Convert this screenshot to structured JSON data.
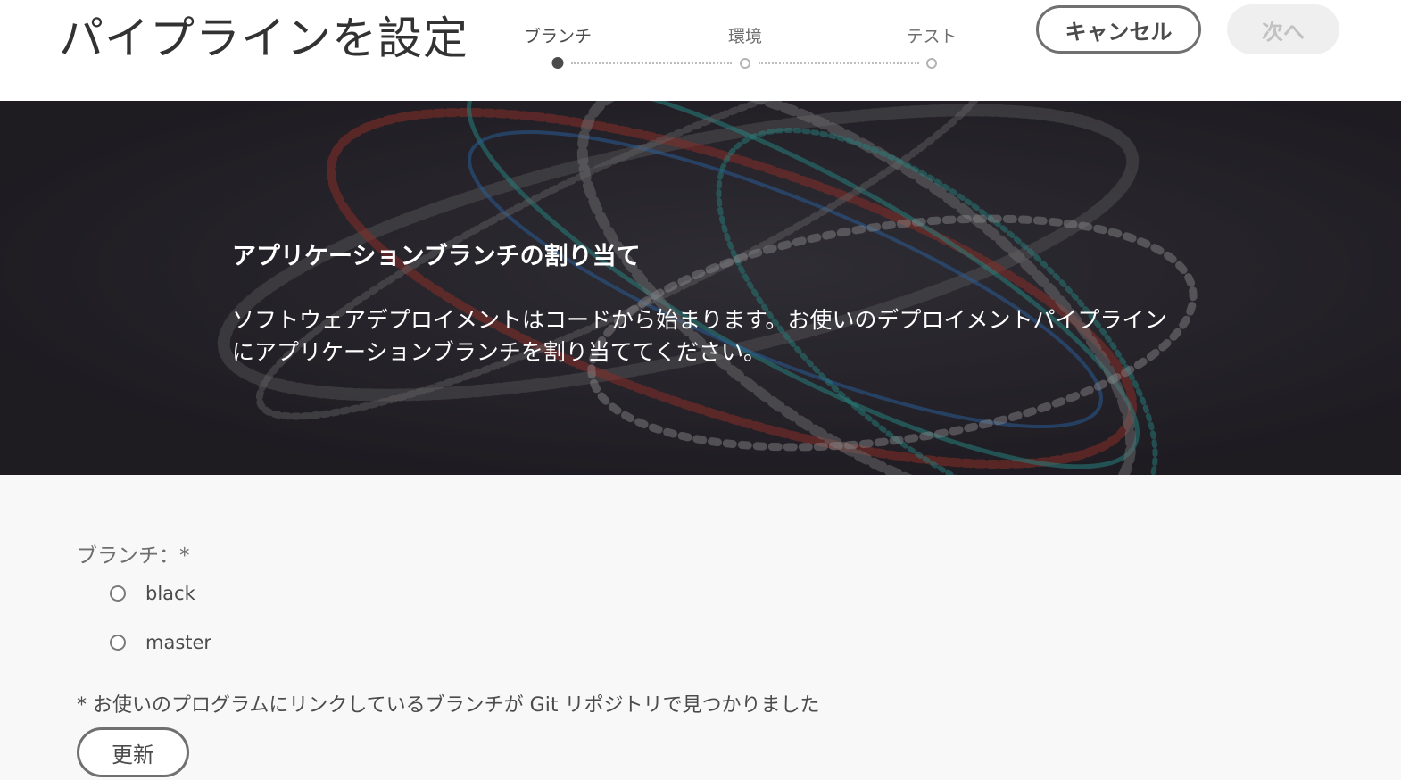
{
  "header": {
    "title": "パイプラインを設定",
    "steps": [
      {
        "label": "ブランチ",
        "state": "active"
      },
      {
        "label": "環境",
        "state": "pending"
      },
      {
        "label": "テスト",
        "state": "pending"
      }
    ],
    "cancel_label": "キャンセル",
    "next_label": "次へ"
  },
  "hero": {
    "title": "アプリケーションブランチの割り当て",
    "description": "ソフトウェアデプロイメントはコードから始まります。お使いのデプロイメントパイプラインにアプリケーションブランチを割り当ててください。"
  },
  "form": {
    "branch_label": "ブランチ：*",
    "options": [
      {
        "label": "black",
        "selected": false
      },
      {
        "label": "master",
        "selected": false
      }
    ],
    "footnote": "* お使いのプログラムにリンクしているブランチが Git リポジトリで見つかりました",
    "refresh_label": "更新"
  },
  "colors": {
    "hero_background": "#25232a",
    "accent_red": "#c0392b",
    "accent_teal": "#2bb5ad",
    "accent_blue": "#2f7dd1"
  }
}
